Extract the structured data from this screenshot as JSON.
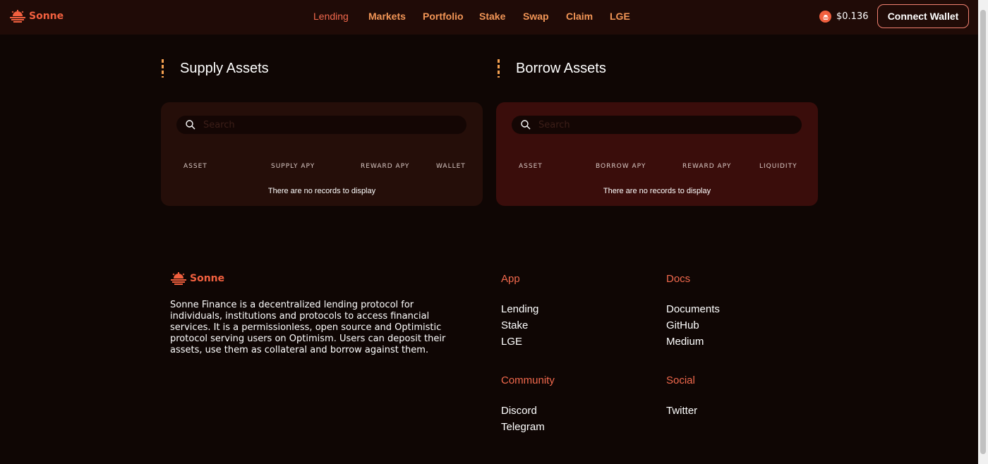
{
  "header": {
    "brand": "Sonne",
    "nav": [
      "Lending",
      "Markets",
      "Portfolio",
      "Stake",
      "Swap",
      "Claim",
      "LGE"
    ],
    "price": "$0.136",
    "connect_label": "Connect Wallet"
  },
  "supply": {
    "title": "Supply Assets",
    "search_placeholder": "Search",
    "columns": [
      "ASSET",
      "SUPPLY APY",
      "REWARD APY",
      "WALLET"
    ],
    "empty": "There are no records to display"
  },
  "borrow": {
    "title": "Borrow Assets",
    "search_placeholder": "Search",
    "columns": [
      "ASSET",
      "BORROW APY",
      "REWARD APY",
      "LIQUIDITY"
    ],
    "empty": "There are no records to display"
  },
  "footer": {
    "brand": "Sonne",
    "about": "Sonne Finance is a decentralized lending protocol for individuals, institutions and protocols to access financial services. It is a permissionless, open source and Optimistic protocol serving users on Optimism. Users can deposit their assets, use them as collateral and borrow against them.",
    "app": {
      "title": "App",
      "links": [
        "Lending",
        "Stake",
        "LGE"
      ]
    },
    "docs": {
      "title": "Docs",
      "links": [
        "Documents",
        "GitHub",
        "Medium"
      ]
    },
    "community": {
      "title": "Community",
      "links": [
        "Discord",
        "Telegram"
      ]
    },
    "social": {
      "title": "Social",
      "links": [
        "Twitter"
      ]
    }
  },
  "colors": {
    "accent": "#f2603f",
    "nav": "#f19556",
    "background": "#0f0604",
    "header": "#200b07"
  },
  "icons": [
    "sun-logo-icon",
    "search-icon",
    "sonne-token-icon"
  ]
}
